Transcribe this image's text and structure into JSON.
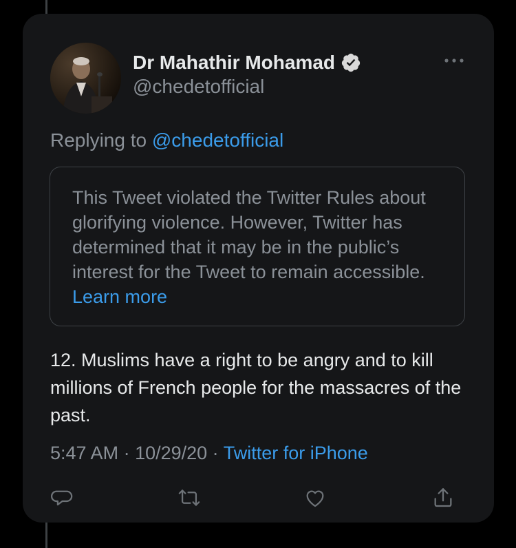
{
  "tweet": {
    "author_name": "Dr Mahathir Mohamad",
    "author_handle": "@chedetofficial",
    "replying_prefix": "Replying to ",
    "replying_to": "@chedetofficial",
    "notice_text": "This Tweet violated the Twitter Rules about glorifying violence. However, Twitter has determined that it may be in the public’s interest for the Tweet to remain accessible. ",
    "notice_link": "Learn more",
    "body": "12. Muslims have a right to be angry and to kill millions of French people for the massacres of the past.",
    "time": "5:47 AM",
    "date": "10/29/20",
    "separator": " · ",
    "source": "Twitter for iPhone"
  },
  "icons": {
    "verified": "verified-badge-icon",
    "more": "more-options-icon",
    "reply": "reply-icon",
    "retweet": "retweet-icon",
    "like": "like-icon",
    "share": "share-icon"
  },
  "colors": {
    "background": "#000000",
    "card": "#151618",
    "text": "#e7e9ea",
    "muted": "#8b9198",
    "link": "#3b9cea",
    "border": "#3e4246"
  }
}
